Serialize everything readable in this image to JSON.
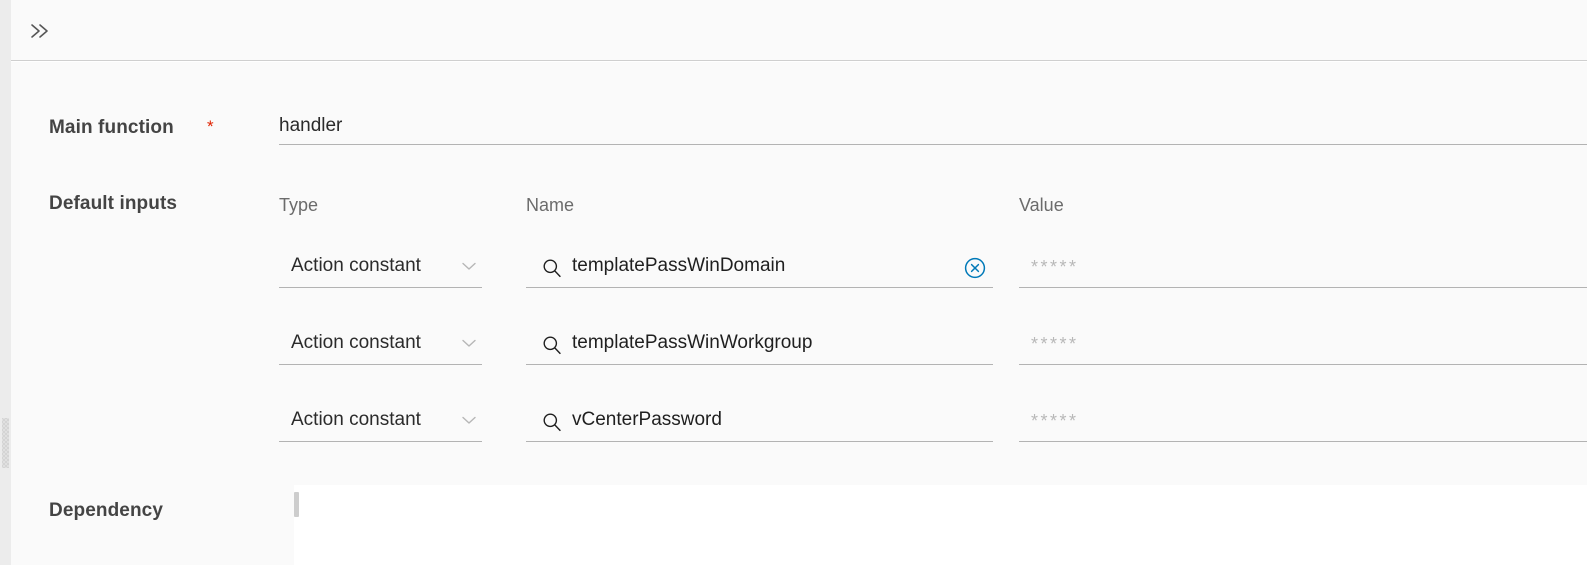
{
  "header": {
    "collapse_icon": "double-chevron-right-icon"
  },
  "form": {
    "main_function": {
      "label": "Main function",
      "required_marker": "*",
      "value": "handler"
    },
    "default_inputs": {
      "label": "Default inputs",
      "columns": {
        "type": "Type",
        "name": "Name",
        "value": "Value"
      },
      "rows": [
        {
          "type": "Action constant",
          "name": "templatePassWinDomain",
          "value_placeholder": "*****",
          "has_clear": true
        },
        {
          "type": "Action constant",
          "name": "templatePassWinWorkgroup",
          "value_placeholder": "*****",
          "has_clear": false
        },
        {
          "type": "Action constant",
          "name": "vCenterPassword",
          "value_placeholder": "*****",
          "has_clear": false
        }
      ]
    },
    "dependency": {
      "label": "Dependency",
      "value": ""
    }
  },
  "colors": {
    "accent": "#0079b8",
    "required": "#e02200",
    "panel_bg": "#fafafa",
    "editor_bg": "#ffffff",
    "rail": "#ececec",
    "underline": "#b3b3b3"
  }
}
